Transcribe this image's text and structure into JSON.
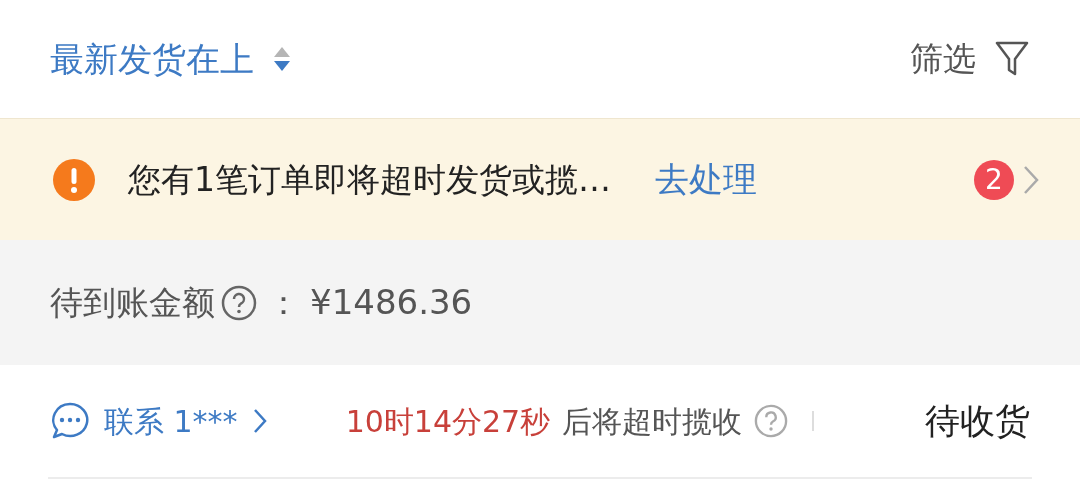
{
  "sort": {
    "label": "最新发货在上"
  },
  "filter": {
    "label": "筛选"
  },
  "alert": {
    "message": "您有1笔订单即将超时发货或揽…",
    "action": "去处理",
    "count": "2"
  },
  "pending_amount": {
    "label": "待到账金额",
    "separator": "：",
    "value": "¥1486.36"
  },
  "order": {
    "contact": "联系 1***",
    "countdown": "10时14分27秒",
    "countdown_suffix": "后将超时揽收",
    "status": "待收货"
  }
}
